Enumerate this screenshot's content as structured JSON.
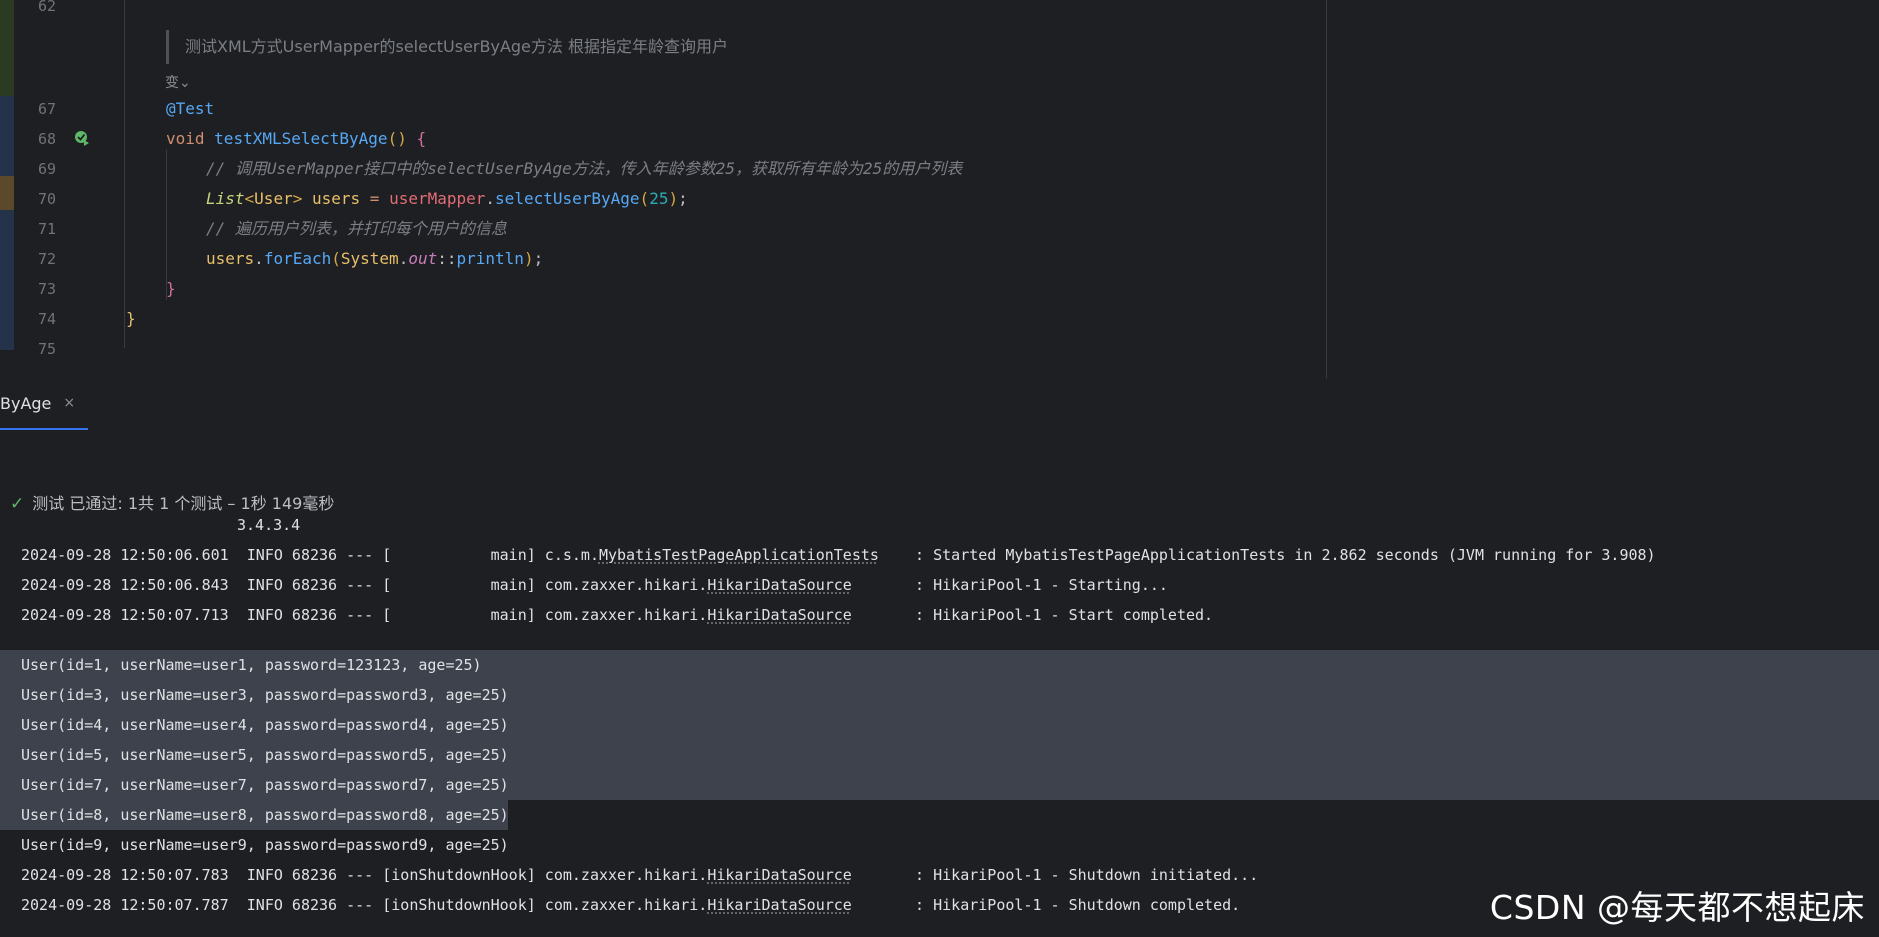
{
  "editor": {
    "line_numbers": [
      "62",
      "67",
      "68",
      "69",
      "70",
      "71",
      "72",
      "73",
      "74",
      "75"
    ],
    "doc_comment": "测试XML方式UserMapper的selectUserByAge方法 根据指定年龄查询用户",
    "usage_hint": "变⌄",
    "code": {
      "l67_annotation": "@Test",
      "l68_void": "void",
      "l68_method": "testXMLSelectByAge",
      "l68_parens": "()",
      "l68_brace": "{",
      "l69_comment": "// 调用UserMapper接口中的selectUserByAge方法，传入年龄参数25，获取所有年龄为25的用户列表",
      "l70_type": "List",
      "l70_lt": "<",
      "l70_generic": "User",
      "l70_gt": ">",
      "l70_var": "users",
      "l70_eq": "=",
      "l70_field": "userMapper",
      "l70_dot": ".",
      "l70_call": "selectUserByAge",
      "l70_open": "(",
      "l70_arg": "25",
      "l70_close": ")",
      "l70_semi": ";",
      "l71_comment": "// 遍历用户列表，并打印每个用户的信息",
      "l72_var": "users",
      "l72_dot": ".",
      "l72_call": "forEach",
      "l72_open": "(",
      "l72_class": "System",
      "l72_dot2": ".",
      "l72_out": "out",
      "l72_ref": "::",
      "l72_println": "println",
      "l72_close": ")",
      "l72_semi": ";",
      "l73_brace": "}",
      "l74_brace": "}"
    }
  },
  "tab": {
    "label": "ByAge",
    "close": "×"
  },
  "console": {
    "status": "测试 已通过: 1共 1 个测试 – 1秒 149毫秒",
    "version": "3.4.3.4",
    "logs": [
      {
        "prefix": "2024-09-28 12:50:06.601  INFO 68236 --- [           main] c.s.m.",
        "cls": "MybatisTestPageApplicationTests",
        "suffix": "    : Started MybatisTestPageApplicationTests in 2.862 seconds (JVM running for 3.908)"
      },
      {
        "prefix": "2024-09-28 12:50:06.843  INFO 68236 --- [           main] com.zaxxer.hikari.",
        "cls": "HikariDataSource",
        "suffix": "       : HikariPool-1 - Starting..."
      },
      {
        "prefix": "2024-09-28 12:50:07.713  INFO 68236 --- [           main] com.zaxxer.hikari.",
        "cls": "HikariDataSource",
        "suffix": "       : HikariPool-1 - Start completed."
      }
    ],
    "users": [
      "User(id=1, userName=user1, password=123123, age=25)",
      "User(id=3, userName=user3, password=password3, age=25)",
      "User(id=4, userName=user4, password=password4, age=25)",
      "User(id=5, userName=user5, password=password5, age=25)",
      "User(id=7, userName=user7, password=password7, age=25)",
      "User(id=8, userName=user8, password=password8, age=25)",
      "User(id=9, userName=user9, password=password9, age=25)"
    ],
    "shutdown_logs": [
      {
        "prefix": "2024-09-28 12:50:07.783  INFO 68236 --- [ionShutdownHook] com.zaxxer.hikari.",
        "cls": "HikariDataSource",
        "suffix": "       : HikariPool-1 - Shutdown initiated..."
      },
      {
        "prefix": "2024-09-28 12:50:07.787  INFO 68236 --- [ionShutdownHook] com.zaxxer.hikari.",
        "cls": "HikariDataSource",
        "suffix": "       : HikariPool-1 - Shutdown completed."
      }
    ]
  },
  "watermark": "CSDN @每天都不想起床",
  "colors": {
    "background": "#1e1f22",
    "selection": "#3d424c",
    "accent": "#3574f0",
    "success": "#5fb865"
  }
}
